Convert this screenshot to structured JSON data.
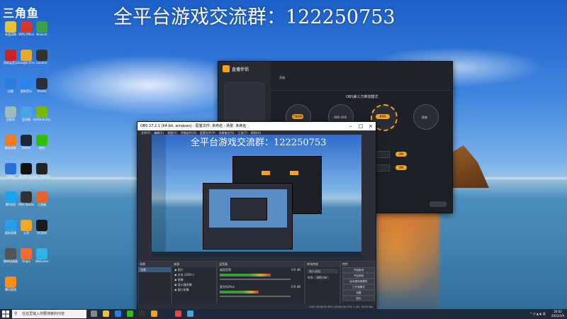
{
  "headline": "全平台游戏交流群：122250753",
  "preview_headline": "全平台游戏交流群：122250753",
  "desktop_logo": "三角鱼",
  "desktop_icons": [
    {
      "label": "有道词典",
      "color": "#e8c13a"
    },
    {
      "label": "WPS Office",
      "color": "#d33a2e"
    },
    {
      "label": "Navicat",
      "color": "#3aa04a"
    },
    {
      "label": "网易云音乐",
      "color": "#c22"
    },
    {
      "label": "Google Chrome",
      "color": "#e6a92d"
    },
    {
      "label": "Counter",
      "color": "#333"
    },
    {
      "label": "迅雷",
      "color": "#2b7de0"
    },
    {
      "label": "酷狗音乐",
      "color": "#2a83e8"
    },
    {
      "label": "Steam",
      "color": "#2a2f3a"
    },
    {
      "label": "回收站",
      "color": "#9bb"
    },
    {
      "label": "此电脑",
      "color": "#4aa3e0"
    },
    {
      "label": "GeForce Experience",
      "color": "#76b900"
    },
    {
      "label": "傲软录屏",
      "color": "#f07a1e"
    },
    {
      "label": "Steam",
      "color": "#1b2838"
    },
    {
      "label": "微信",
      "color": "#2dc100"
    },
    {
      "label": "Uplay",
      "color": "#2a6fd6"
    },
    {
      "label": "Bandicam",
      "color": "#111"
    },
    {
      "label": "Epic Games",
      "color": "#222"
    },
    {
      "label": "腾讯QQ",
      "color": "#1aa3f0"
    },
    {
      "label": "OBS Studio",
      "color": "#333"
    },
    {
      "label": "工具箱",
      "color": "#e8622b"
    },
    {
      "label": "酷狗直播",
      "color": "#27a0e9"
    },
    {
      "label": "斗鱼",
      "color": "#f5a623"
    },
    {
      "label": "QQ游戏",
      "color": "#1a1a1a"
    },
    {
      "label": "雷神加速器",
      "color": "#555"
    },
    {
      "label": "Origin",
      "color": "#f56c2d"
    },
    {
      "label": "WeGame",
      "color": "#2fb3e6"
    },
    {
      "label": "腾讯视频",
      "color": "#ff8c1a"
    }
  ],
  "stream_window": {
    "brand": "直播伴侣",
    "mode_title": "OBS第三方推流模式",
    "tab_start": "开始",
    "btn_start": "开始直播",
    "btn_obs": "OBS LIVE",
    "btn_push": "推流码",
    "label_server": "服务器地址",
    "label_key": "串流密钥",
    "copy": "复制",
    "end": "结束"
  },
  "obs": {
    "title": "OBS 27.2.1 (64-bit, windows) - 配置文件: 未命名 - 场景: 未命名",
    "menu": [
      "文件(F)",
      "编辑(E)",
      "视图(V)",
      "停靠部件(D)",
      "配置文件(P)",
      "场景集合(S)",
      "工具(T)",
      "帮助(H)"
    ],
    "docks": {
      "scenes": "场景",
      "sources": "来源",
      "mixer": "混音器",
      "transitions": "转场特效",
      "controls": "控件"
    },
    "scene_items": [
      "场景"
    ],
    "source_items": [
      "图片",
      "文本 (GDI+)",
      "图像",
      "显示器采集",
      "窗口采集"
    ],
    "mixer_items": [
      {
        "name": "桌面音频",
        "db": "0.0 dB",
        "level": 0.72
      },
      {
        "name": "麦克风/Aux",
        "db": "0.0 dB",
        "level": 0.55
      }
    ],
    "transition_type": "淡入淡出",
    "transition_duration_label": "时长",
    "transition_duration": "300 ms",
    "controls": [
      "开始推流",
      "开始录制",
      "启动虚拟摄像机",
      "工作室模式",
      "设置",
      "退出"
    ],
    "status": "LIVE: 00:00:00   REC: 00:00:00   CPU: 1.4%, 30.00 fps"
  },
  "taskbar": {
    "search_placeholder": "在这里输入你要搜索的内容",
    "time": "20:02",
    "date": "2022/2/9"
  }
}
